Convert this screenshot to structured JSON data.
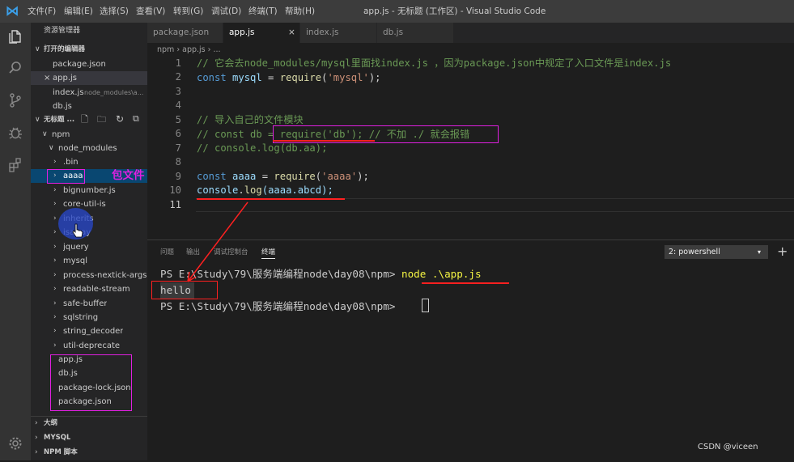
{
  "window": {
    "title": "app.js - 无标题 (工作区) - Visual Studio Code"
  },
  "menu": [
    "文件(F)",
    "编辑(E)",
    "选择(S)",
    "查看(V)",
    "转到(G)",
    "调试(D)",
    "终端(T)",
    "帮助(H)"
  ],
  "activity_icons": [
    "explorer-icon",
    "search-icon",
    "source-control-icon",
    "debug-icon",
    "extensions-icon",
    "gear-icon"
  ],
  "sidebar": {
    "title": "资源管理器",
    "open_editors": {
      "header": "打开的编辑器",
      "items": [
        {
          "name": "package.json"
        },
        {
          "name": "app.js",
          "close": "×"
        },
        {
          "name": "index.js",
          "hint": "node_modules\\a..."
        },
        {
          "name": "db.js"
        }
      ]
    },
    "workspace": {
      "header": "无标题 ...",
      "root": "npm",
      "node_modules": "node_modules",
      "folders": [
        ".bin",
        "aaaa",
        "bignumber.js",
        "core-util-is",
        "inherits",
        "isarray",
        "jquery",
        "mysql",
        "process-nextick-args",
        "readable-stream",
        "safe-buffer",
        "sqlstring",
        "string_decoder",
        "util-deprecate"
      ],
      "files": [
        "app.js",
        "db.js",
        "package-lock.json",
        "package.json"
      ]
    },
    "sections": [
      "大纲",
      "MYSQL",
      "NPM 脚本"
    ]
  },
  "annotation": {
    "package_label": "包文件"
  },
  "tabs": [
    {
      "label": "package.json",
      "active": false
    },
    {
      "label": "app.js",
      "active": true,
      "close": "×"
    },
    {
      "label": "index.js",
      "active": false
    },
    {
      "label": "db.js",
      "active": false
    }
  ],
  "breadcrumb": "npm › app.js › ...",
  "editor": {
    "line_numbers": [
      "1",
      "2",
      "3",
      "4",
      "5",
      "6",
      "7",
      "8",
      "9",
      "10",
      "11"
    ],
    "code": {
      "l1": "// 它会去node_modules/mysql里面找index.js ，因为package.json中规定了入口文件是index.js",
      "l2_kw": "const",
      "l2_var": " mysql",
      "l2_op": " = ",
      "l2_fn": "require",
      "l2_open": "(",
      "l2_str": "'mysql'",
      "l2_close": ");",
      "l5": "// 导入自己的文件模块",
      "l6_a": "// const db = ",
      "l6_b": "require('db'); // 不加 ./ 就会报错",
      "l7": "// console.log(db.aa);",
      "l9_kw": "const",
      "l9_var": " aaaa",
      "l9_op": " = ",
      "l9_fn": "require",
      "l9_open": "(",
      "l9_str": "'aaaa'",
      "l9_close": ");",
      "l10_var": "console",
      "l10_dot": ".",
      "l10_fn": "log",
      "l10_rest": "(aaaa.abcd);"
    }
  },
  "panel": {
    "tabs": [
      "问题",
      "输出",
      "调试控制台",
      "终端"
    ],
    "active_tab": "终端",
    "terminal_select": "2: powershell",
    "caret": "▾",
    "add": "+",
    "terminal": {
      "prompt": "PS E:\\Study\\79\\服务端编程node\\day08\\npm> ",
      "command": "node .\\app.js",
      "output": "hello",
      "prompt2": "PS E:\\Study\\79\\服务端编程node\\day08\\npm> "
    }
  },
  "watermark": "CSDN @viceen",
  "colors": {
    "annotation": "#e020e0",
    "underline": "#ff2020",
    "accent": "#007acc"
  }
}
